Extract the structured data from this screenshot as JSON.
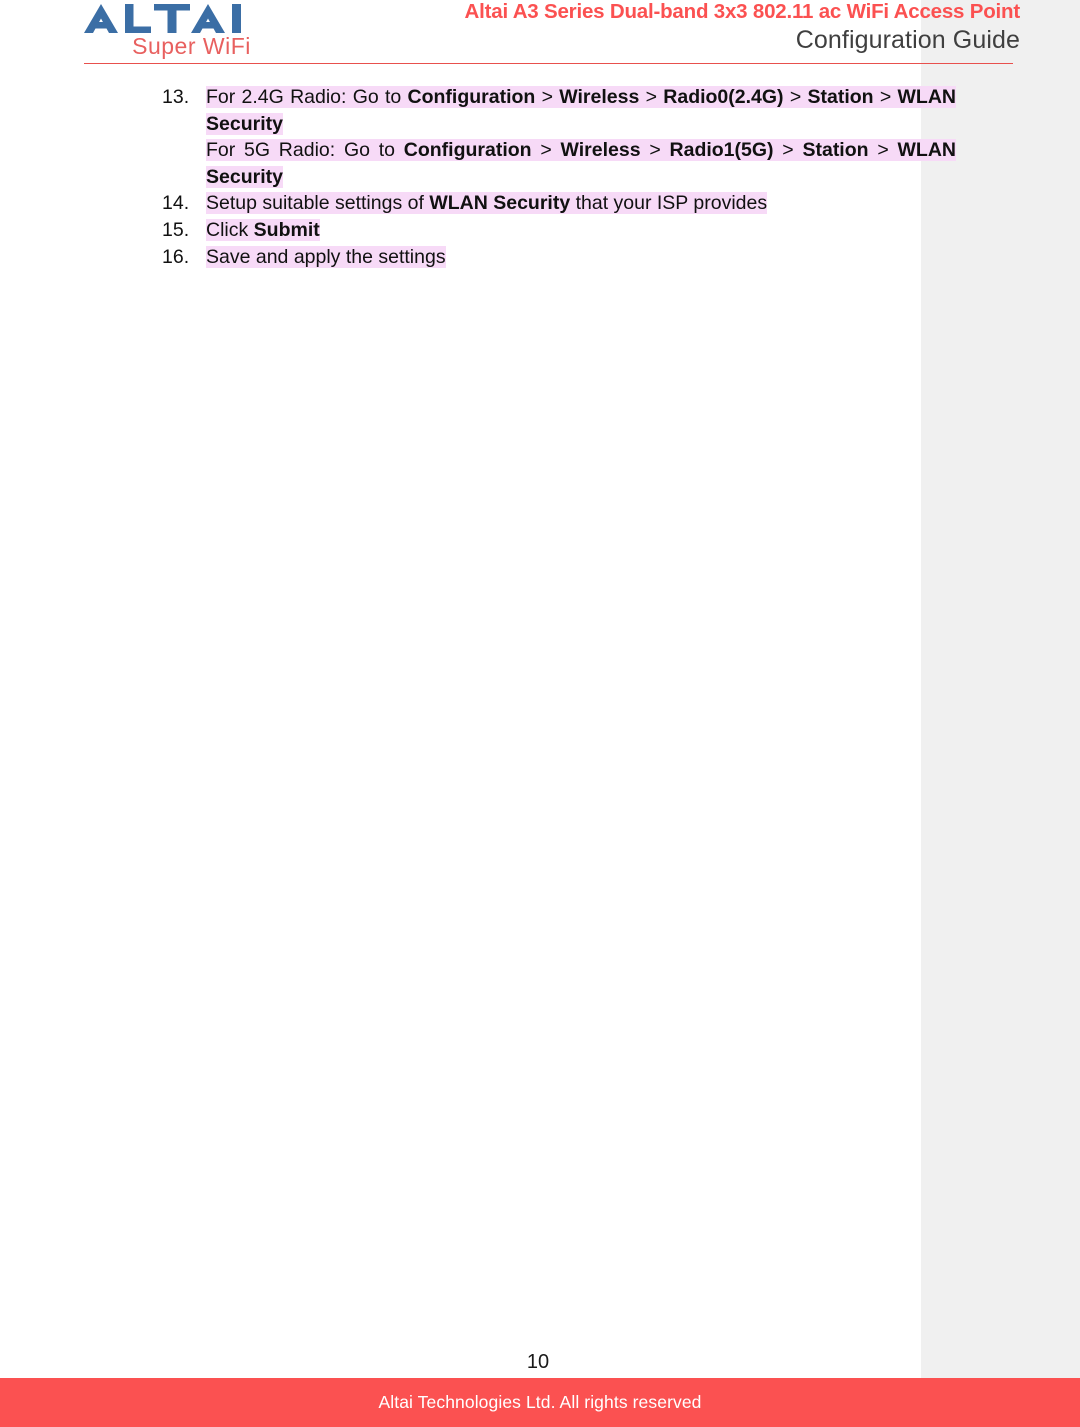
{
  "header": {
    "logo": {
      "wordmark": "ALTAI",
      "tagline": "Super WiFi",
      "wordmark_color": "#3b6ea5",
      "tagline_color": "#e8605f"
    },
    "title_main": "Altai A3 Series Dual-band 3x3 802.11 ac WiFi Access Point",
    "title_sub": "Configuration Guide",
    "rule_color": "#e8504d"
  },
  "content": {
    "items": [
      {
        "number": "13.",
        "lines": [
          {
            "parts": [
              {
                "text": "For 2.4G Radio: Go to ",
                "bold": false,
                "highlight": true
              },
              {
                "text": "Configuration",
                "bold": true,
                "highlight": true
              },
              {
                "text": " > ",
                "bold": false,
                "highlight": true
              },
              {
                "text": "Wireless",
                "bold": true,
                "highlight": true
              },
              {
                "text": " > ",
                "bold": false,
                "highlight": true
              },
              {
                "text": "Radio0(2.4G)",
                "bold": true,
                "highlight": true
              },
              {
                "text": " > ",
                "bold": false,
                "highlight": true
              },
              {
                "text": "Station",
                "bold": true,
                "highlight": true
              },
              {
                "text": " > ",
                "bold": false,
                "highlight": true
              },
              {
                "text": "WLAN Security",
                "bold": true,
                "highlight": true
              }
            ]
          },
          {
            "parts": [
              {
                "text": "For 5G Radio: Go to ",
                "bold": false,
                "highlight": true
              },
              {
                "text": "Configuration",
                "bold": true,
                "highlight": true
              },
              {
                "text": " > ",
                "bold": false,
                "highlight": true
              },
              {
                "text": "Wireless",
                "bold": true,
                "highlight": true
              },
              {
                "text": " > ",
                "bold": false,
                "highlight": true
              },
              {
                "text": "Radio1(5G)",
                "bold": true,
                "highlight": true
              },
              {
                "text": " > ",
                "bold": false,
                "highlight": true
              },
              {
                "text": "Station",
                "bold": true,
                "highlight": true
              },
              {
                "text": " > ",
                "bold": false,
                "highlight": true
              },
              {
                "text": "WLAN Security",
                "bold": true,
                "highlight": true
              }
            ]
          }
        ]
      },
      {
        "number": "14.",
        "lines": [
          {
            "parts": [
              {
                "text": "Setup suitable settings of ",
                "bold": false,
                "highlight": true
              },
              {
                "text": "WLAN Security",
                "bold": true,
                "highlight": true
              },
              {
                "text": " that your  ISP provides",
                "bold": false,
                "highlight": true
              }
            ]
          }
        ]
      },
      {
        "number": "15.",
        "lines": [
          {
            "parts": [
              {
                "text": "Click ",
                "bold": false,
                "highlight": true
              },
              {
                "text": "Submit",
                "bold": true,
                "highlight": true
              }
            ]
          }
        ]
      },
      {
        "number": "16.",
        "lines": [
          {
            "parts": [
              {
                "text": "Save and apply the settings",
                "bold": false,
                "highlight": true
              }
            ]
          }
        ]
      }
    ],
    "highlight_color": "#f7daf7"
  },
  "footer": {
    "page_number": "10",
    "copyright": "Altai Technologies Ltd. All rights reserved",
    "bar_color": "#fb5151"
  }
}
